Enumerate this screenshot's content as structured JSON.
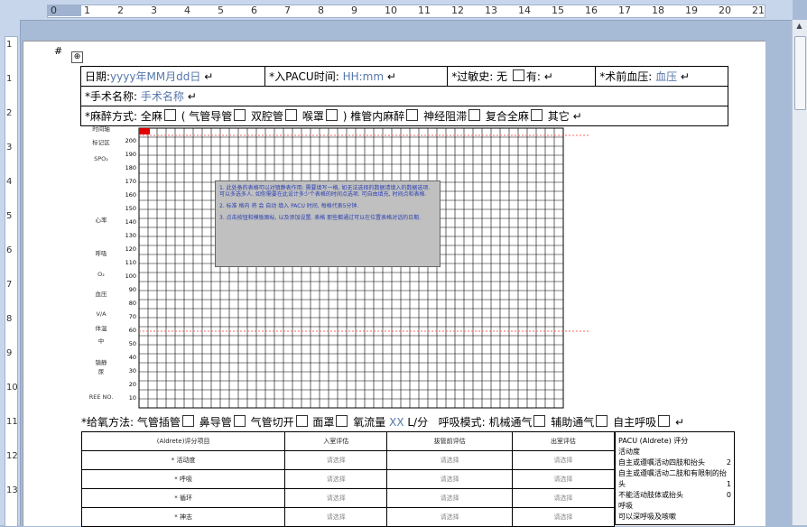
{
  "ruler": {
    "h": [
      "0",
      "1",
      "2",
      "3",
      "4",
      "5",
      "6",
      "7",
      "8",
      "9",
      "10",
      "11",
      "12",
      "13",
      "14",
      "15",
      "16",
      "17",
      "18",
      "19",
      "20",
      "21"
    ],
    "v": [
      "1",
      "1",
      "2",
      "3",
      "4",
      "5",
      "6",
      "7",
      "8",
      "9",
      "10",
      "11",
      "12",
      "13"
    ]
  },
  "anchor": "⊕",
  "header": {
    "date_label": "日期:",
    "date_value": "yyyy年MM月dd日",
    "pacu_label": "*入PACU时间:",
    "pacu_value": "HH:mm",
    "allergy_label": "*过敏史: 无",
    "allergy_yes": "有:",
    "bp_label": "*术前血压:",
    "bp_value": "血压",
    "surgery_label": "*手术名称:",
    "surgery_value": "手术名称",
    "anes_label": "*麻醉方式:",
    "anes_options": [
      "全麻",
      "( 气管导管",
      "双腔管",
      "喉罩",
      ") 椎管内麻醉",
      "神经阻滞",
      "复合全麻",
      "其它"
    ]
  },
  "chart": {
    "side_labels": [
      "时间轴",
      "标记区",
      "SPO₂",
      "心率",
      "呼吸",
      "O₂",
      "血压",
      "V/A",
      "体温",
      "中",
      "镇静",
      "尿",
      "REE NO."
    ],
    "y_ticks": [
      "200",
      "190",
      "180",
      "170",
      "160",
      "150",
      "140",
      "130",
      "120",
      "110",
      "100",
      "90",
      "80",
      "70",
      "60",
      "50",
      "40",
      "30",
      "20",
      "10"
    ]
  },
  "note": {
    "p1": "1. 此处备的表格可以对镇静表作用: 需要填写一格, 如无法选择的数据请填入的数据选项. 可以多选多人. 如你需要在此设计多少个表格的时间点选项. 可自由填充, 时间点和表格.",
    "p2": "2. 标准 格内 将 会 自动 填入 PACU 时间, 每格代表5分钟.",
    "p3": "3. 点击按钮和模板图标, 以及添加设置. 表格 那些都通过可以在位置表格对话的日期."
  },
  "oxygen": {
    "label": "*给氧方法:",
    "options": [
      "气管插管",
      "鼻导管",
      "气管切开",
      "面罩"
    ],
    "flow_label": "氧流量",
    "flow_value": "XX",
    "flow_unit": "L/分",
    "mode_label": "呼吸模式:",
    "modes": [
      "机械通气",
      "辅助通气",
      "自主呼吸"
    ]
  },
  "aldrete": {
    "headers": [
      "(Aldrete)评分项目",
      "入室评估",
      "拔管前评估",
      "出室评估"
    ],
    "rows": [
      {
        "item": "* 活动度",
        "v1": "请选择",
        "v2": "请选择",
        "v3": "请选择"
      },
      {
        "item": "* 呼吸",
        "v1": "请选择",
        "v2": "请选择",
        "v3": "请选择"
      },
      {
        "item": "* 循环",
        "v1": "请选择",
        "v2": "请选择",
        "v3": "请选择"
      },
      {
        "item": "* 神志",
        "v1": "请选择",
        "v2": "请选择",
        "v3": "请选择"
      }
    ]
  },
  "side_box": {
    "title": "PACU (Aldrete) 评分",
    "lines": [
      "活动度",
      "自主或遵嘱活动四肢和抬头",
      "自主或遵嘱活动二肢和有限制的抬头",
      "不能活动肢体或抬头",
      "呼吸",
      "可以深呼吸及咳嗽"
    ],
    "scores": [
      "2",
      "1",
      "0"
    ]
  }
}
